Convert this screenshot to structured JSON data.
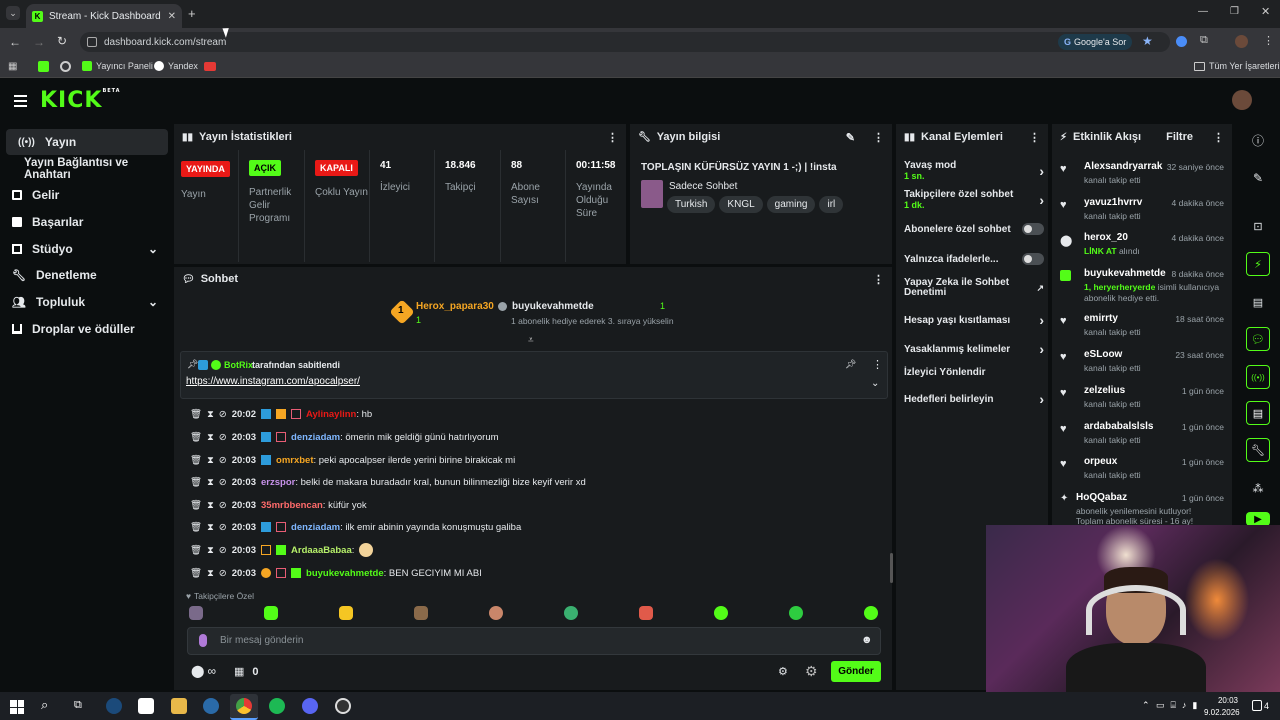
{
  "browser": {
    "tab_title": "Stream - Kick Dashboard",
    "url": "dashboard.kick.com/stream",
    "google_button": "Google'a Sor",
    "bookmarks": [
      "Yayıncı Paneli",
      "Yandex"
    ],
    "all_bookmarks": "Tüm Yer İşaretleri"
  },
  "app": {
    "logo": "KICK",
    "logo_sup": "BETA"
  },
  "sidebar": {
    "items": [
      {
        "label": "Yayın"
      },
      {
        "label": "Yayın Bağlantısı ve Anahtarı"
      },
      {
        "label": "Gelir"
      },
      {
        "label": "Başarılar"
      },
      {
        "label": "Stüdyo"
      },
      {
        "label": "Denetleme"
      },
      {
        "label": "Topluluk"
      },
      {
        "label": "Droplar ve ödüller"
      }
    ]
  },
  "stats": {
    "title": "Yayın İstatistikleri",
    "cols": [
      {
        "badge": "YAYINDA",
        "label": "Yayın"
      },
      {
        "badge": "AÇIK",
        "label": "Partnerlik Gelir Programı"
      },
      {
        "badge": "KAPALI",
        "label": "Çoklu Yayın"
      },
      {
        "value": "41",
        "label": "İzleyici"
      },
      {
        "value": "18.846",
        "label": "Takipçi"
      },
      {
        "value": "88",
        "label": "Abone Sayısı"
      },
      {
        "value": "00:11:58",
        "label": "Yayında Olduğu Süre"
      }
    ]
  },
  "stream_info": {
    "title": "Yayın bilgisi",
    "stream_title": "TOPLAŞIN KÜFÜRSÜZ YAYIN 1 -;) | !insta",
    "category": "Sadece Sohbet",
    "tags": [
      "Turkish",
      "KNGL",
      "gaming",
      "irl"
    ]
  },
  "chat": {
    "title": "Sohbet",
    "top_gifter": "Herox_papara30",
    "top_gifter_count": "1",
    "gifter2": "buyukevahmetde",
    "gifter2_count": "1",
    "gifter2_note": "1 abonelik hediye ederek 3. sıraya yükselin",
    "pinned_by": "BotRix",
    "pinned_suffix": "tarafından sabitlendi",
    "pinned_link": "https://www.instagram.com/apocalpser/",
    "messages": [
      {
        "time": "20:02",
        "user": "Aylinaylinn",
        "text": ": hb"
      },
      {
        "time": "20:03",
        "user": "denziadam",
        "text": ": ömerin mik geldiği günü hatırlıyorum"
      },
      {
        "time": "20:03",
        "user": "omrxbet",
        "text": ": peki apocalpser ilerde yerini birine birakicak mi"
      },
      {
        "time": "20:03",
        "user": "erzspor",
        "text": ": belki de makara buradadır kral, bunun bilinmezliği bize keyif verir xd"
      },
      {
        "time": "20:03",
        "user": "35mrbbencan",
        "text": ": küfür yok"
      },
      {
        "time": "20:03",
        "user": "denziadam",
        "text": ": ilk emir abinin yayında konuşmuştu galiba"
      },
      {
        "time": "20:03",
        "user": "ArdaaaBabaa",
        "text": ":"
      },
      {
        "time": "20:03",
        "user": "buyukevahmetde",
        "text": ": BEN GECIYIM MI ABI"
      }
    ],
    "emote_section": "Takipçilere Özel",
    "input_placeholder": "Bir mesaj gönderin",
    "points": "0",
    "send_label": "Gönder"
  },
  "channel_actions": {
    "title": "Kanal Eylemleri",
    "items": [
      {
        "label": "Yavaş mod",
        "sub": "1 sn."
      },
      {
        "label": "Takipçilere özel sohbet",
        "sub": "1 dk."
      },
      {
        "label": "Abonelere özel sohbet"
      },
      {
        "label": "Yalnızca ifadelerle..."
      },
      {
        "label": "Yapay Zeka ile Sohbet Denetimi"
      },
      {
        "label": "Hesap yaşı kısıtlaması"
      },
      {
        "label": "Yasaklanmış kelimeler"
      },
      {
        "label": "İzleyici Yönlendir"
      },
      {
        "label": "Hedefleri belirleyin"
      }
    ]
  },
  "activity": {
    "title": "Etkinlik Akışı",
    "filter": "Filtre",
    "events": [
      {
        "name": "Alexsandryarrak",
        "time": "32 saniye önce",
        "desc": "kanalı takip etti"
      },
      {
        "name": "yavuz1hvrrv",
        "time": "4 dakika önce",
        "desc": "kanalı takip etti"
      },
      {
        "name": "herox_20",
        "time": "4 dakika önce",
        "desc_strong": "LİNK AT",
        "desc": " alındı"
      },
      {
        "name": "buyukevahmetde",
        "time": "8 dakika önce",
        "desc_strong": "1, heryerheryerde",
        "desc": " isimli kullanıcıya abonelik hediye etti."
      },
      {
        "name": "emirrty",
        "time": "18 saat önce",
        "desc": "kanalı takip etti"
      },
      {
        "name": "eSLoow",
        "time": "23 saat önce",
        "desc": "kanalı takip etti"
      },
      {
        "name": "zelzelius",
        "time": "1 gün önce",
        "desc": "kanalı takip etti"
      },
      {
        "name": "ardababalslsls",
        "time": "1 gün önce",
        "desc": "kanalı takip etti"
      },
      {
        "name": "orpeux",
        "time": "1 gün önce",
        "desc": "kanalı takip etti"
      },
      {
        "name": "HoQQabaz",
        "time": "1 gün önce",
        "desc": "abonelik yenilemesini kutluyor! Toplam abonelik süresi - 16 ay!"
      }
    ]
  },
  "taskbar": {
    "time": "20:03",
    "date": "9.02.2026",
    "notif": "4"
  },
  "colors": {
    "accent": "#53fc18",
    "live_red": "#e91916",
    "panel": "#181b1d"
  }
}
